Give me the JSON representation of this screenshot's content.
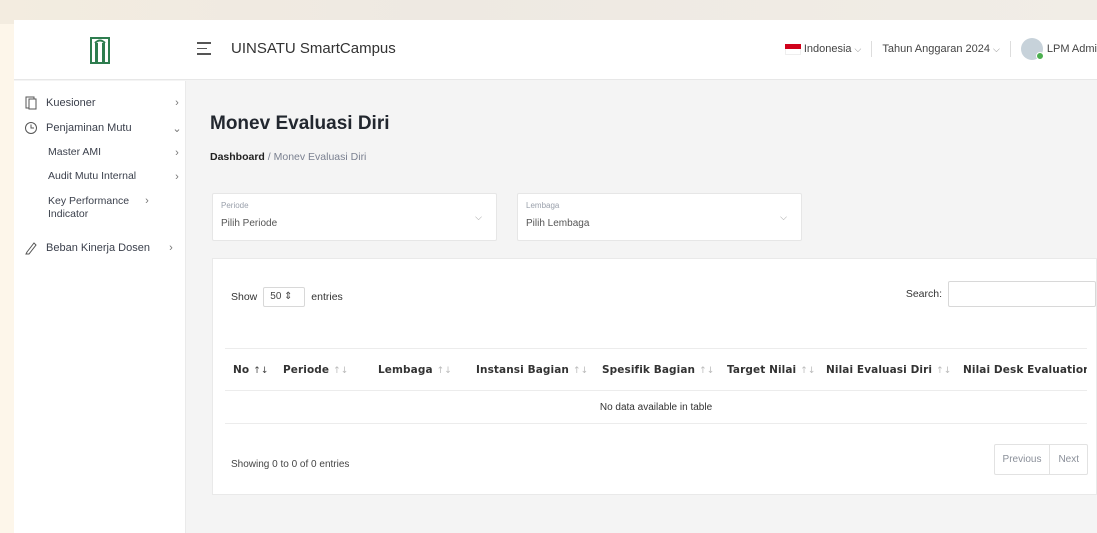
{
  "header": {
    "app_title": "UINSATU SmartCampus",
    "language": "Indonesia",
    "budget_year": "Tahun Anggaran 2024",
    "user": "LPM Admi"
  },
  "sidebar": {
    "items": [
      {
        "label": "Kuesioner",
        "icon": "document-icon"
      },
      {
        "label": "Penjaminan Mutu",
        "icon": "clock-icon"
      },
      {
        "label": "Master AMI"
      },
      {
        "label": "Audit Mutu Internal"
      },
      {
        "label": "Key Performance Indicator"
      },
      {
        "label": "Beban Kinerja Dosen",
        "icon": "pen-icon"
      }
    ]
  },
  "page": {
    "title": "Monev Evaluasi Diri",
    "breadcrumb_home": "Dashboard",
    "breadcrumb_sep": "/",
    "breadcrumb_current": "Monev Evaluasi Diri"
  },
  "filters": {
    "periode": {
      "label": "Periode",
      "value": "Pilih Periode"
    },
    "lembaga": {
      "label": "Lembaga",
      "value": "Pilih Lembaga"
    }
  },
  "table": {
    "show_label": "Show",
    "entries_value": "50",
    "entries_label": "entries",
    "search_label": "Search:",
    "columns": [
      "No",
      "Periode",
      "Lembaga",
      "Instansi Bagian",
      "Spesifik Bagian",
      "Target Nilai",
      "Nilai Evaluasi Diri",
      "Nilai Desk Evaluation"
    ],
    "empty_message": "No data available in table",
    "info": "Showing 0 to 0 of 0 entries",
    "previous": "Previous",
    "next": "Next"
  }
}
